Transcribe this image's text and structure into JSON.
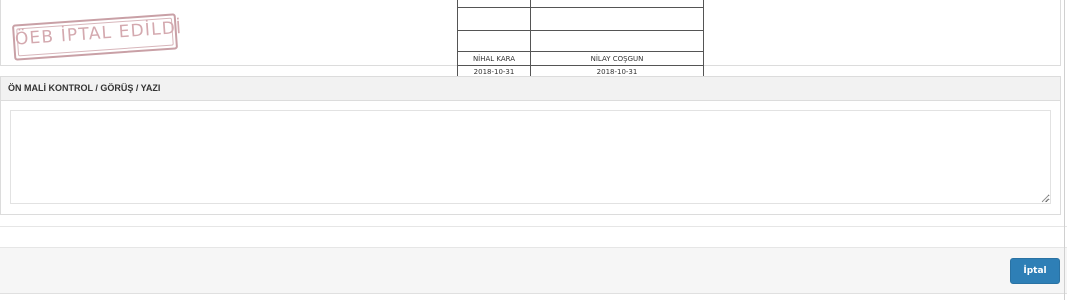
{
  "stamp": {
    "text": "ÖEB İPTAL EDİLDİ",
    "color": "#c9a0a6"
  },
  "signature_table": {
    "names": [
      "NİHAL KARA",
      "NİLAY COŞGUN"
    ],
    "dates": [
      "2018-10-31",
      "2018-10-31"
    ]
  },
  "section": {
    "title": "ÖN MALİ KONTROL / GÖRÜŞ / YAZI",
    "textarea_value": ""
  },
  "footer": {
    "cancel_label": "İptal",
    "cancel_color": "#2e7fb6"
  }
}
